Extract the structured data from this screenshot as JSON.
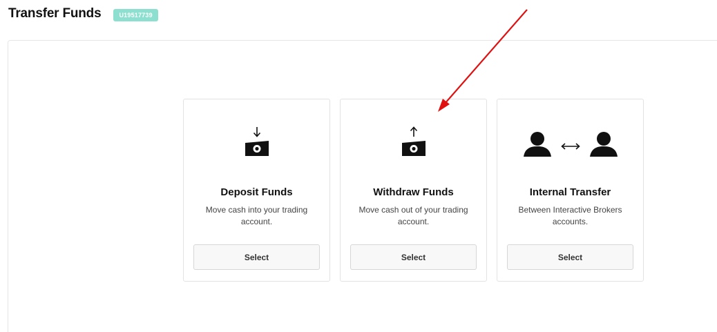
{
  "header": {
    "title": "Transfer Funds",
    "account_id": "U19517739"
  },
  "cards": [
    {
      "title": "Deposit Funds",
      "description": "Move cash into your trading account.",
      "button_label": "Select",
      "icon": "deposit-cash-icon"
    },
    {
      "title": "Withdraw Funds",
      "description": "Move cash out of your trading account.",
      "button_label": "Select",
      "icon": "withdraw-cash-icon"
    },
    {
      "title": "Internal Transfer",
      "description": "Between Interactive Brokers accounts.",
      "button_label": "Select",
      "icon": "users-transfer-icon"
    }
  ],
  "colors": {
    "badge": "#8de0cf",
    "annotation_arrow": "#e01010"
  }
}
